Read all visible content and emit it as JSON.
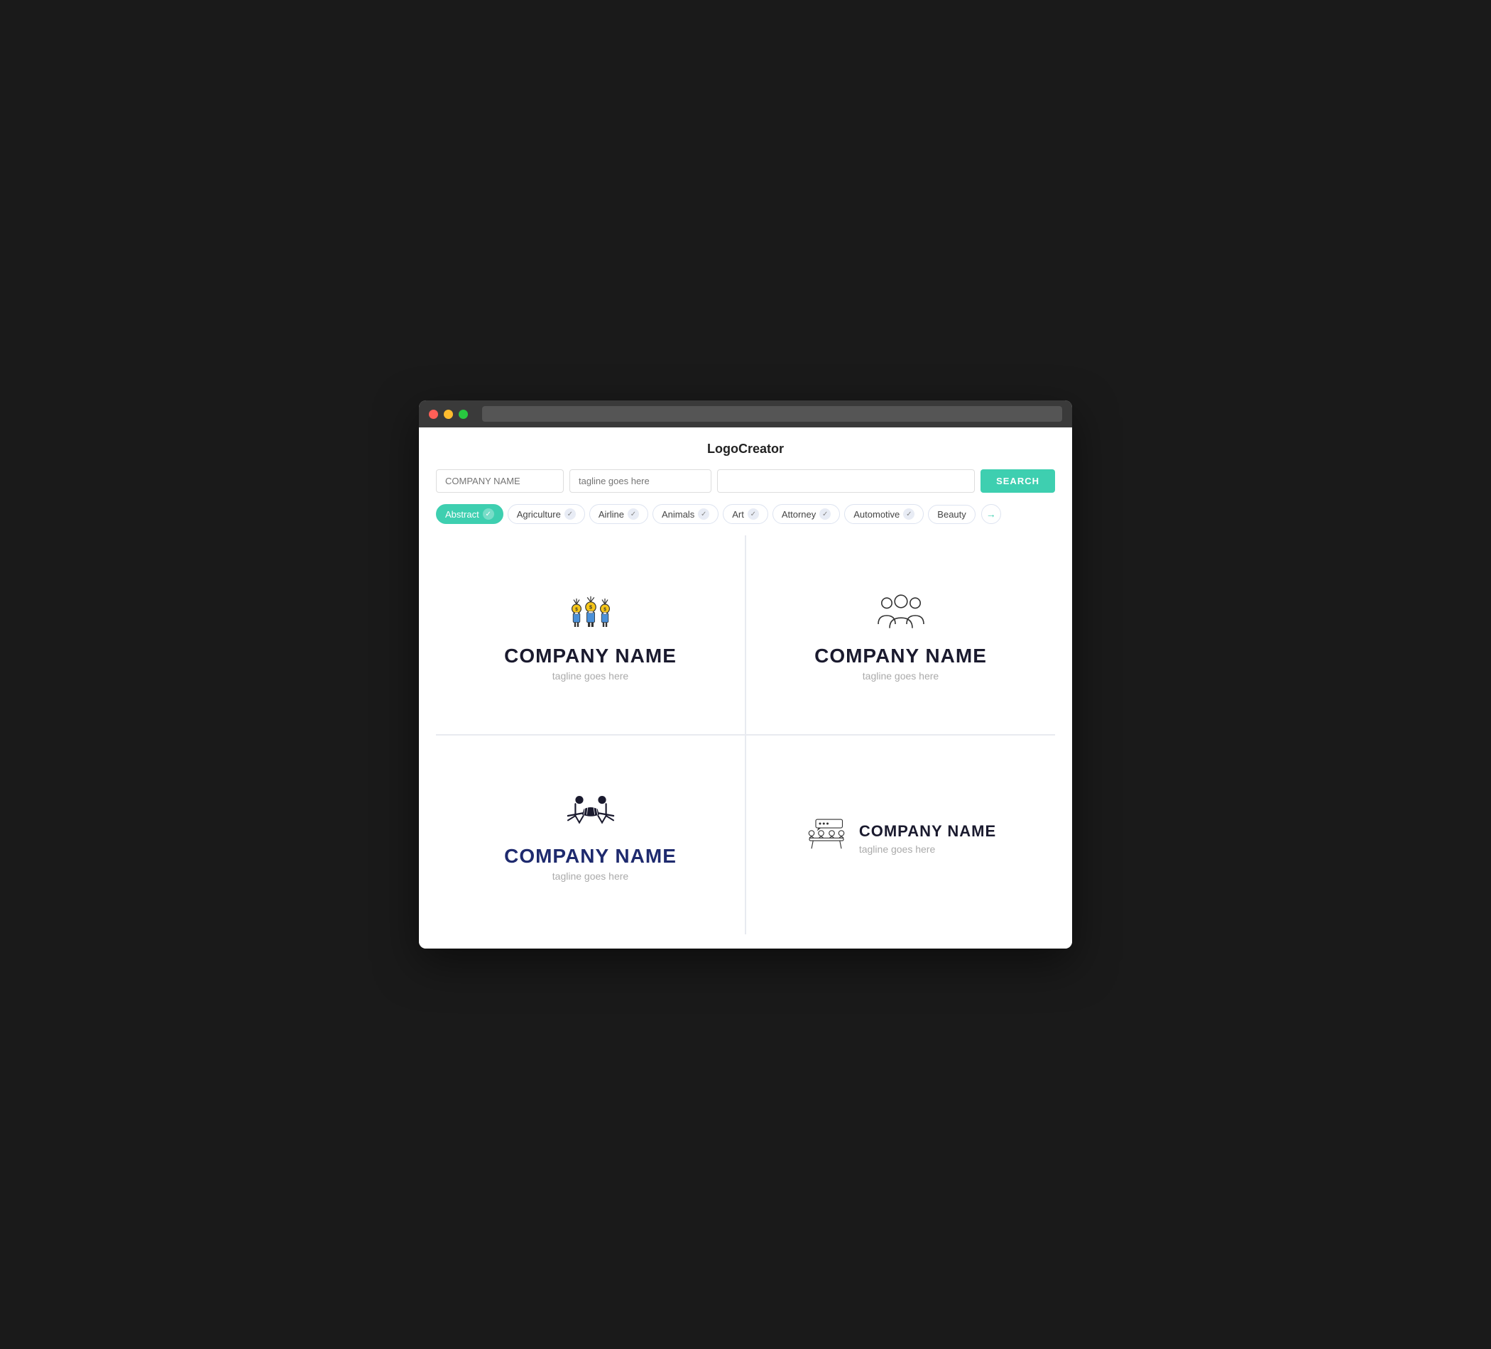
{
  "app": {
    "title": "LogoCreator"
  },
  "search": {
    "company_placeholder": "COMPANY NAME",
    "tagline_placeholder": "tagline goes here",
    "keyword_placeholder": "",
    "button_label": "SEARCH"
  },
  "filters": [
    {
      "id": "abstract",
      "label": "Abstract",
      "active": true
    },
    {
      "id": "agriculture",
      "label": "Agriculture",
      "active": false
    },
    {
      "id": "airline",
      "label": "Airline",
      "active": false
    },
    {
      "id": "animals",
      "label": "Animals",
      "active": false
    },
    {
      "id": "art",
      "label": "Art",
      "active": false
    },
    {
      "id": "attorney",
      "label": "Attorney",
      "active": false
    },
    {
      "id": "automotive",
      "label": "Automotive",
      "active": false
    },
    {
      "id": "beauty",
      "label": "Beauty",
      "active": false
    }
  ],
  "logos": [
    {
      "id": "logo1",
      "company_name": "COMPANY NAME",
      "tagline": "tagline goes here",
      "layout": "stacked",
      "name_color": "dark"
    },
    {
      "id": "logo2",
      "company_name": "COMPANY NAME",
      "tagline": "tagline goes here",
      "layout": "stacked",
      "name_color": "dark"
    },
    {
      "id": "logo3",
      "company_name": "COMPANY NAME",
      "tagline": "tagline goes here",
      "layout": "stacked",
      "name_color": "blue"
    },
    {
      "id": "logo4",
      "company_name": "COMPANY NAME",
      "tagline": "tagline goes here",
      "layout": "inline",
      "name_color": "dark"
    }
  ]
}
